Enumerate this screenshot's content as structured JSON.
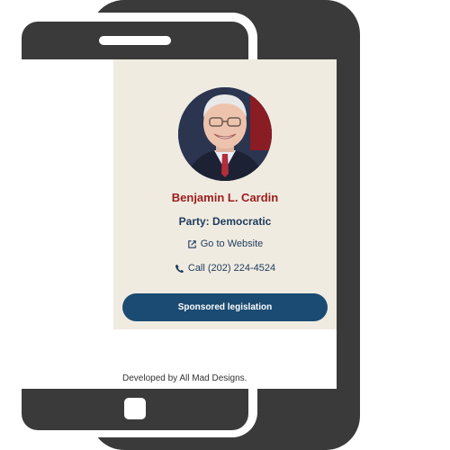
{
  "profile": {
    "name": "Benjamin L. Cardin",
    "party": "Party: Democratic",
    "website_label": "Go to Website",
    "phone_label": "Call (202) 224-4524"
  },
  "actions": {
    "sponsored_legislation_label": "Sponsored legislation"
  },
  "footer": {
    "credit": "Developed by All Mad Designs."
  },
  "icons": {
    "website": "external-link-icon",
    "phone": "phone-icon"
  },
  "colors": {
    "name": "#9b1c1c",
    "party": "#1b3b5c",
    "button": "#1b4b72",
    "card_background": "#f0ebe1",
    "phone_frame": "#3a3a3a"
  }
}
